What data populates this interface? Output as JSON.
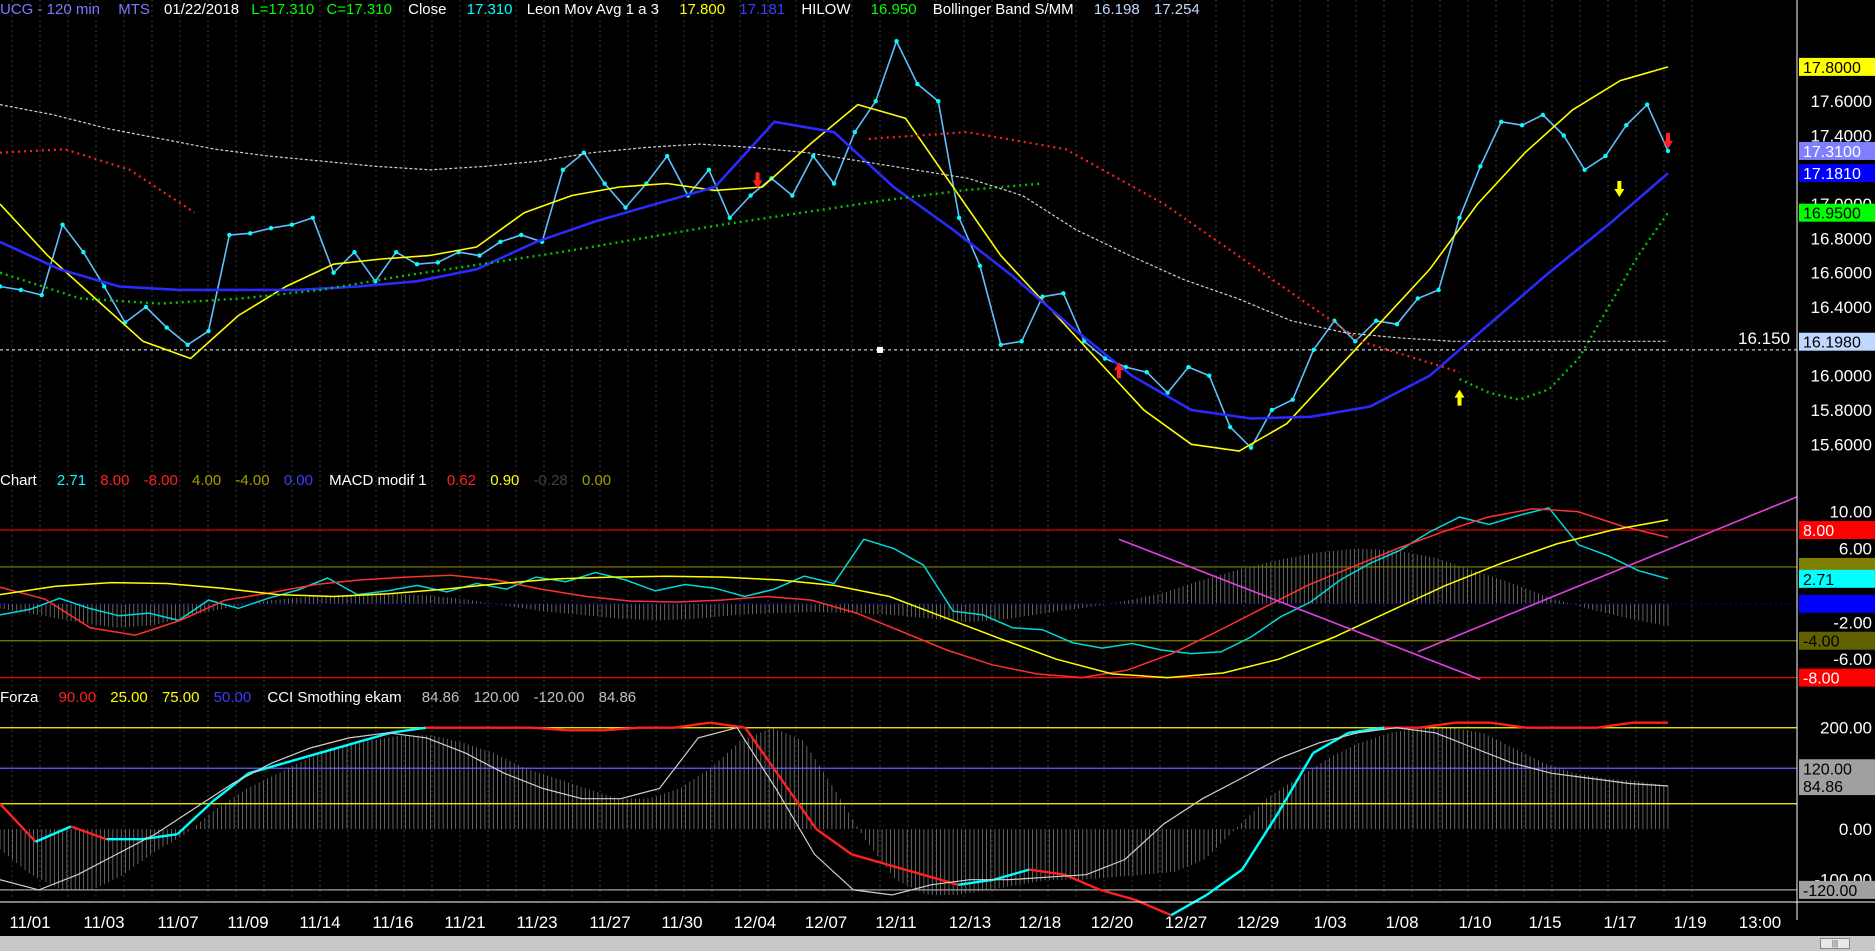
{
  "header": {
    "symbol": "UCG - 120 min",
    "exchange": "MTS",
    "date": "01/22/2018",
    "low": "L=17.310",
    "close_val": "C=17.310",
    "close_label": "Close",
    "close_num": "17.310",
    "leon_label": "Leon Mov Avg 1 a 3",
    "leon_v1": "17.800",
    "leon_v2": "17.181",
    "hilow_label": "HILOW",
    "hilow_v": "16.950",
    "boll_label": "Bollinger Band S/MM",
    "boll_v1": "16.198",
    "boll_v2": "17.254"
  },
  "macd_header": {
    "name": "Chart",
    "v1": "2.71",
    "v2": "8.00",
    "v3": "-8.00",
    "v4": "4.00",
    "v5": "-4.00",
    "v6": "0.00",
    "macd_label": "MACD modif 1",
    "m1": "0.62",
    "m2": "0.90",
    "m3": "-0.28",
    "m4": "0.00"
  },
  "cci_header": {
    "name": "Forza",
    "v1": "90.00",
    "v2": "25.00",
    "v3": "75.00",
    "v4": "50.00",
    "cci_label": "CCI Smothing ekam",
    "c1": "84.86",
    "c2": "120.00",
    "c3": "-120.00",
    "c4": "84.86"
  },
  "price_axis": {
    "ticks": [
      "17.8000",
      "17.6000",
      "17.4000",
      "17.2000",
      "17.0000",
      "16.8000",
      "16.6000",
      "16.4000",
      "16.2000",
      "16.0000",
      "15.8000",
      "15.6000"
    ],
    "markers": [
      {
        "label": "17.8000",
        "value": 17.8,
        "bg": "#ffff00",
        "fg": "#000000"
      },
      {
        "label": "17.3100",
        "value": 17.31,
        "bg": "#8080ff",
        "fg": "#ffffff"
      },
      {
        "label": "17.1810",
        "value": 17.181,
        "bg": "#0000ff",
        "fg": "#ffffff"
      },
      {
        "label": "16.9500",
        "value": 16.95,
        "bg": "#00ff00",
        "fg": "#000000"
      },
      {
        "label": "16.1980",
        "value": 16.198,
        "bg": "#c0d8ff",
        "fg": "#000000"
      }
    ],
    "hline_value": 16.15,
    "hline_label": "16.150"
  },
  "macd_axis": {
    "ticks": [
      "10.00",
      "6.00",
      "-2.00",
      "-6.00"
    ],
    "markers": [
      {
        "label": "8.00",
        "value": 8,
        "bg": "#ff0000",
        "fg": "#ffffff"
      },
      {
        "label": "4.00",
        "value": 4,
        "bg": "#808000",
        "fg": "#808000"
      },
      {
        "label": "2.71",
        "value": 2.71,
        "bg": "#00ffff",
        "fg": "#000000"
      },
      {
        "label": "0.00",
        "value": 0,
        "bg": "#0000ff",
        "fg": "#0000ff"
      },
      {
        "label": "-4.00",
        "value": -4,
        "bg": "#606000",
        "fg": "#000000"
      },
      {
        "label": "-8.00",
        "value": -8,
        "bg": "#ff0000",
        "fg": "#ffffff"
      }
    ]
  },
  "cci_axis": {
    "ticks": [
      "200.00",
      "0.00",
      "-100.00"
    ],
    "markers": [
      {
        "label": "120.00",
        "value": 120,
        "bg": "#a0a0a0",
        "fg": "#000000"
      },
      {
        "label": "84.86",
        "value": 84.86,
        "bg": "#a0a0a0",
        "fg": "#000000"
      },
      {
        "label": "-120.00",
        "value": -120,
        "bg": "#a0a0a0",
        "fg": "#000000"
      }
    ]
  },
  "x_labels": [
    "11/01",
    "11/03",
    "11/07",
    "11/09",
    "11/14",
    "11/16",
    "11/21",
    "11/23",
    "11/27",
    "11/30",
    "12/04",
    "12/07",
    "12/11",
    "12/13",
    "12/18",
    "12/20",
    "12/27",
    "12/29",
    "1/03",
    "1/08",
    "1/10",
    "1/15",
    "1/17",
    "1/19",
    "13:00"
  ],
  "scroll_thumb": "|||",
  "chart_data": [
    {
      "type": "line",
      "panel": "price",
      "x": [
        0,
        3,
        6,
        9,
        12,
        15,
        18,
        21,
        24,
        27,
        30,
        33,
        36,
        39,
        42,
        45,
        48,
        51,
        54,
        57,
        60,
        63,
        66,
        69,
        72,
        75,
        78,
        81,
        84,
        87,
        90,
        93,
        96,
        99,
        102,
        105,
        108,
        111,
        114,
        117,
        120,
        123,
        126,
        129,
        132,
        135,
        138,
        141,
        144,
        147,
        150,
        153,
        156,
        159,
        162,
        165,
        168,
        171,
        174,
        177,
        180,
        183,
        186,
        189,
        192,
        195,
        198,
        201,
        204,
        207,
        210,
        213,
        216,
        219,
        222,
        225,
        228,
        231,
        234,
        237,
        240
      ],
      "series": [
        {
          "key": "close",
          "color": "#5fbfff",
          "values": [
            16.52,
            16.5,
            16.47,
            16.88,
            16.72,
            16.52,
            16.31,
            16.4,
            16.28,
            16.18,
            16.26,
            16.82,
            16.83,
            16.86,
            16.88,
            16.92,
            16.6,
            16.72,
            16.55,
            16.72,
            16.65,
            16.66,
            16.72,
            16.7,
            16.78,
            16.82,
            16.78,
            17.2,
            17.3,
            17.12,
            16.98,
            17.12,
            17.28,
            17.05,
            17.2,
            16.92,
            17.05,
            17.15,
            17.05,
            17.28,
            17.12,
            17.42,
            17.6,
            17.95,
            17.7,
            17.6,
            16.92,
            16.64,
            16.18,
            16.2,
            16.46,
            16.48,
            16.2,
            16.1,
            16.05,
            16.02,
            15.9,
            16.05,
            16.0,
            15.7,
            15.58,
            15.8,
            15.86,
            16.15,
            16.32,
            16.2,
            16.32,
            16.3,
            16.45,
            16.5,
            16.92,
            17.22,
            17.48,
            17.46,
            17.52,
            17.4,
            17.2,
            17.28,
            17.46,
            17.58,
            17.31
          ]
        },
        {
          "key": "leon_yellow",
          "color": "#ffff00",
          "values": [
            17.0,
            16.7,
            16.45,
            16.2,
            16.1,
            16.35,
            16.52,
            16.65,
            16.68,
            16.7,
            16.75,
            16.95,
            17.05,
            17.1,
            17.12,
            17.08,
            17.1,
            17.35,
            17.58,
            17.5,
            17.1,
            16.7,
            16.4,
            16.1,
            15.8,
            15.6,
            15.56,
            15.72,
            16.02,
            16.32,
            16.62,
            17.0,
            17.3,
            17.55,
            17.72,
            17.8
          ]
        },
        {
          "key": "leon_blue",
          "color": "#2a2aff",
          "values": [
            16.78,
            16.62,
            16.52,
            16.5,
            16.5,
            16.5,
            16.52,
            16.55,
            16.62,
            16.78,
            16.9,
            17.0,
            17.1,
            17.48,
            17.42,
            17.1,
            16.85,
            16.58,
            16.28,
            16.0,
            15.8,
            15.75,
            15.76,
            15.82,
            16.0,
            16.3,
            16.6,
            16.88,
            17.18
          ]
        },
        {
          "key": "hilow_green",
          "color": "#00c800",
          "values": [
            16.6,
            16.45,
            16.42,
            16.45,
            16.5,
            16.58,
            16.65,
            16.72,
            16.8,
            16.88,
            16.95,
            17.02,
            17.08,
            17.12,
            15.98,
            15.9,
            15.86,
            15.92,
            16.1,
            16.4,
            16.7,
            16.95
          ]
        },
        {
          "key": "boll_red",
          "color": "#ff2020",
          "values": [
            17.3,
            17.32,
            17.2,
            16.95,
            17.38,
            17.42,
            17.32,
            17.0,
            16.6,
            16.2,
            16.02
          ]
        },
        {
          "key": "boll_white",
          "color": "#d0d0d0",
          "values": [
            17.58,
            17.52,
            17.44,
            17.38,
            17.32,
            17.28,
            17.25,
            17.22,
            17.2,
            17.22,
            17.25,
            17.3,
            17.33,
            17.35,
            17.33,
            17.3,
            17.25,
            17.2,
            17.15,
            17.05,
            16.85,
            16.7,
            16.56,
            16.45,
            16.32,
            16.25,
            16.22,
            16.2,
            16.2,
            16.2,
            16.2,
            16.2
          ]
        }
      ],
      "arrows": [
        {
          "x": 109,
          "value": 17.15,
          "dir": "down",
          "color": "#ff2020"
        },
        {
          "x": 161,
          "value": 16.02,
          "dir": "up",
          "color": "#ff2020"
        },
        {
          "x": 210,
          "value": 15.86,
          "dir": "up",
          "color": "#ffff00"
        },
        {
          "x": 233,
          "value": 17.1,
          "dir": "down",
          "color": "#ffff00"
        },
        {
          "x": 240,
          "value": 17.38,
          "dir": "down",
          "color": "#ff2020"
        }
      ],
      "ylim": [
        15.45,
        18.05
      ]
    },
    {
      "type": "line",
      "panel": "macd",
      "hlines": [
        {
          "value": 8,
          "color": "#ff0000"
        },
        {
          "value": 4,
          "color": "#808000"
        },
        {
          "value": 0,
          "color": "#0000aa"
        },
        {
          "value": -4,
          "color": "#808000"
        },
        {
          "value": -8,
          "color": "#ff0000"
        }
      ],
      "histogram": [
        -0.5,
        -1.2,
        -2.0,
        -2.6,
        -2.3,
        -1.2,
        -0.3,
        0.4,
        0.8,
        1.0,
        1.1,
        0.9,
        0.5,
        -0.2,
        -0.8,
        -1.2,
        -1.6,
        -1.8,
        -1.6,
        -1.2,
        -1.0,
        -0.9,
        -1.0,
        -1.2,
        -1.6,
        -2.0,
        -1.6,
        -1.0,
        -0.4,
        0.3,
        1.2,
        2.6,
        3.8,
        4.8,
        5.6,
        6.0,
        5.8,
        5.0,
        3.6,
        2.2,
        0.6,
        -0.6,
        -1.6,
        -2.4
      ],
      "series": [
        {
          "key": "cyan",
          "color": "#00d8d8",
          "values": [
            -1.2,
            -0.6,
            0.6,
            -0.5,
            -1.3,
            -1.0,
            -1.8,
            0.4,
            -0.5,
            0.6,
            1.5,
            2.8,
            1.0,
            1.4,
            2.0,
            1.3,
            2.2,
            1.6,
            2.9,
            2.4,
            3.4,
            2.6,
            1.4,
            2.1,
            1.7,
            0.8,
            1.6,
            3.0,
            2.2,
            7.0,
            6.0,
            4.2,
            -0.8,
            -1.2,
            -2.6,
            -2.8,
            -4.2,
            -4.8,
            -4.3,
            -5.0,
            -5.4,
            -5.2,
            -3.6,
            -1.4,
            0.2,
            2.6,
            4.4,
            5.8,
            7.8,
            9.4,
            8.6,
            9.6,
            10.4,
            6.4,
            5.2,
            3.6,
            2.71
          ]
        },
        {
          "key": "red",
          "color": "#ff3030",
          "values": [
            1.8,
            0.5,
            -2.6,
            -3.4,
            -1.8,
            0.4,
            1.2,
            2.1,
            2.6,
            2.9,
            3.1,
            2.6,
            1.6,
            0.8,
            0.3,
            0.2,
            0.4,
            0.8,
            0.4,
            -1.0,
            -3.0,
            -5.0,
            -6.6,
            -7.6,
            -8.0,
            -7.2,
            -5.4,
            -3.0,
            -0.5,
            2.0,
            4.0,
            6.0,
            7.8,
            9.4,
            10.3,
            10.0,
            8.4,
            7.2
          ]
        },
        {
          "key": "yellow",
          "color": "#ffff00",
          "values": [
            1.0,
            1.9,
            2.3,
            2.2,
            1.7,
            1.0,
            0.8,
            1.1,
            1.6,
            2.2,
            2.7,
            2.9,
            3.0,
            2.9,
            2.6,
            2.0,
            0.8,
            -1.5,
            -3.8,
            -6.0,
            -7.6,
            -8.0,
            -7.5,
            -6.0,
            -3.6,
            -0.8,
            2.0,
            4.4,
            6.5,
            8.0,
            9.1
          ]
        },
        {
          "key": "magenta_down",
          "color": "#e040e0",
          "values": [
            7.0,
            -8.2
          ]
        },
        {
          "key": "magenta_up",
          "color": "#e040e0",
          "values": [
            -5.2,
            11.6
          ]
        }
      ],
      "ylim": [
        -8.8,
        11.8
      ]
    },
    {
      "type": "line",
      "panel": "cci",
      "hlines": [
        {
          "value": 200,
          "color": "#ffff00"
        },
        {
          "value": 120,
          "color": "#6060ff"
        },
        {
          "value": 50,
          "color": "#ffff00"
        },
        {
          "value": -120,
          "color": "#a0a0a0"
        }
      ],
      "histogram": [
        -40,
        -90,
        -120,
        -120,
        -90,
        -45,
        -10,
        40,
        80,
        110,
        140,
        160,
        175,
        185,
        185,
        170,
        150,
        120,
        100,
        80,
        60,
        60,
        80,
        120,
        175,
        200,
        175,
        80,
        -20,
        -100,
        -130,
        -130,
        -120,
        -110,
        -100,
        -100,
        -95,
        -90,
        -85,
        -60,
        0,
        60,
        100,
        140,
        170,
        190,
        200,
        200,
        190,
        160,
        130,
        110,
        100,
        95,
        85
      ],
      "series": [
        {
          "key": "cci_main",
          "color": "#00ffff",
          "values": [
            50,
            -25,
            5,
            -20,
            -20,
            -10,
            55,
            110,
            130,
            150,
            170,
            190,
            200,
            200,
            200,
            200,
            195,
            195,
            200,
            200,
            210,
            200,
            100,
            0,
            -50,
            -70,
            -90,
            -110,
            -100,
            -80,
            -90,
            -120,
            -140,
            -170,
            -130,
            -80,
            30,
            150,
            190,
            200,
            200,
            210,
            210,
            200,
            200,
            200,
            210,
            210
          ]
        },
        {
          "key": "cci_white",
          "color": "#d0d0d0",
          "values": [
            -100,
            -120,
            -90,
            -50,
            -10,
            40,
            90,
            130,
            160,
            180,
            190,
            180,
            150,
            110,
            80,
            60,
            60,
            80,
            180,
            200,
            80,
            -50,
            -120,
            -130,
            -110,
            -100,
            -100,
            -95,
            -90,
            -60,
            10,
            60,
            100,
            140,
            170,
            190,
            200,
            190,
            160,
            130,
            110,
            100,
            90,
            85
          ]
        }
      ],
      "ylim": [
        -140,
        235
      ]
    }
  ]
}
